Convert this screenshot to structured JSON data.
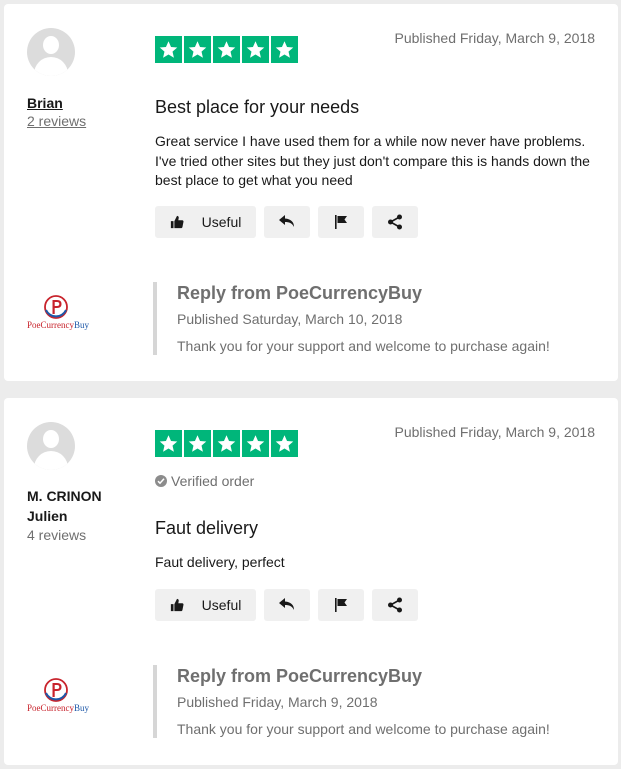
{
  "reviews": [
    {
      "author": "Brian",
      "reviews_count": "2 reviews",
      "rating": 5,
      "date": "Published Friday, March 9, 2018",
      "verified": "",
      "title": "Best place for your needs",
      "text": "Great service I have used them for a while now never have problems. I've tried other sites but they just don't compare this is hands down the best place to get what you need",
      "useful_label": "Useful",
      "reply": {
        "title": "Reply from PoeCurrencyBuy",
        "date": "Published Saturday, March 10, 2018",
        "text": "Thank you for your support and welcome to purchase again!"
      }
    },
    {
      "author": "M. CRINON Julien",
      "reviews_count": "4 reviews",
      "rating": 5,
      "date": "Published Friday, March 9, 2018",
      "verified": "Verified order",
      "title": "Faut delivery",
      "text": "Faut delivery, perfect",
      "useful_label": "Useful",
      "reply": {
        "title": "Reply from PoeCurrencyBuy",
        "date": "Published Friday, March 9, 2018",
        "text": "Thank you for your support and welcome to purchase again!"
      }
    }
  ],
  "logo": {
    "wordmark_a": "PoeCurrency",
    "wordmark_b": "Buy"
  },
  "colors": {
    "star_green": "#00b67a",
    "muted_text": "#6f6f6f",
    "button_bg": "#f0f0f0"
  }
}
